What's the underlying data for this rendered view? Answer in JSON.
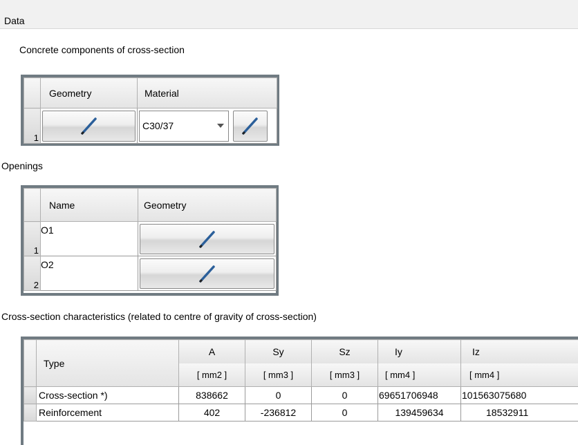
{
  "panel": {
    "title": "Data"
  },
  "concrete": {
    "title": "Concrete components of cross-section",
    "headers": {
      "geometry": "Geometry",
      "material": "Material"
    },
    "rows": [
      {
        "index": "1",
        "material": "C30/37"
      }
    ]
  },
  "openings": {
    "title": "Openings",
    "headers": {
      "name": "Name",
      "geometry": "Geometry"
    },
    "rows": [
      {
        "index": "1",
        "name": "O1"
      },
      {
        "index": "2",
        "name": "O2"
      }
    ]
  },
  "characteristics": {
    "title": "Cross-section characteristics (related to centre of gravity of cross-section)",
    "headers": {
      "type": "Type",
      "cols": [
        {
          "name": "A",
          "unit": "[ mm2 ]"
        },
        {
          "name": "Sy",
          "unit": "[ mm3 ]"
        },
        {
          "name": "Sz",
          "unit": "[ mm3 ]"
        },
        {
          "name": "Iy",
          "unit": "[ mm4 ]"
        },
        {
          "name": "Iz",
          "unit": "[ mm4 ]"
        }
      ]
    },
    "rows": [
      {
        "type": "Cross-section *)",
        "values": [
          "838662",
          "0",
          "0",
          "69651706948",
          "101563075680"
        ]
      },
      {
        "type": "Reinforcement",
        "values": [
          "402",
          "-236812",
          "0",
          "139459634",
          "18532911"
        ]
      }
    ]
  },
  "icons": {
    "edit": "pencil-icon",
    "dropdown": "dropdown-arrow-icon"
  }
}
